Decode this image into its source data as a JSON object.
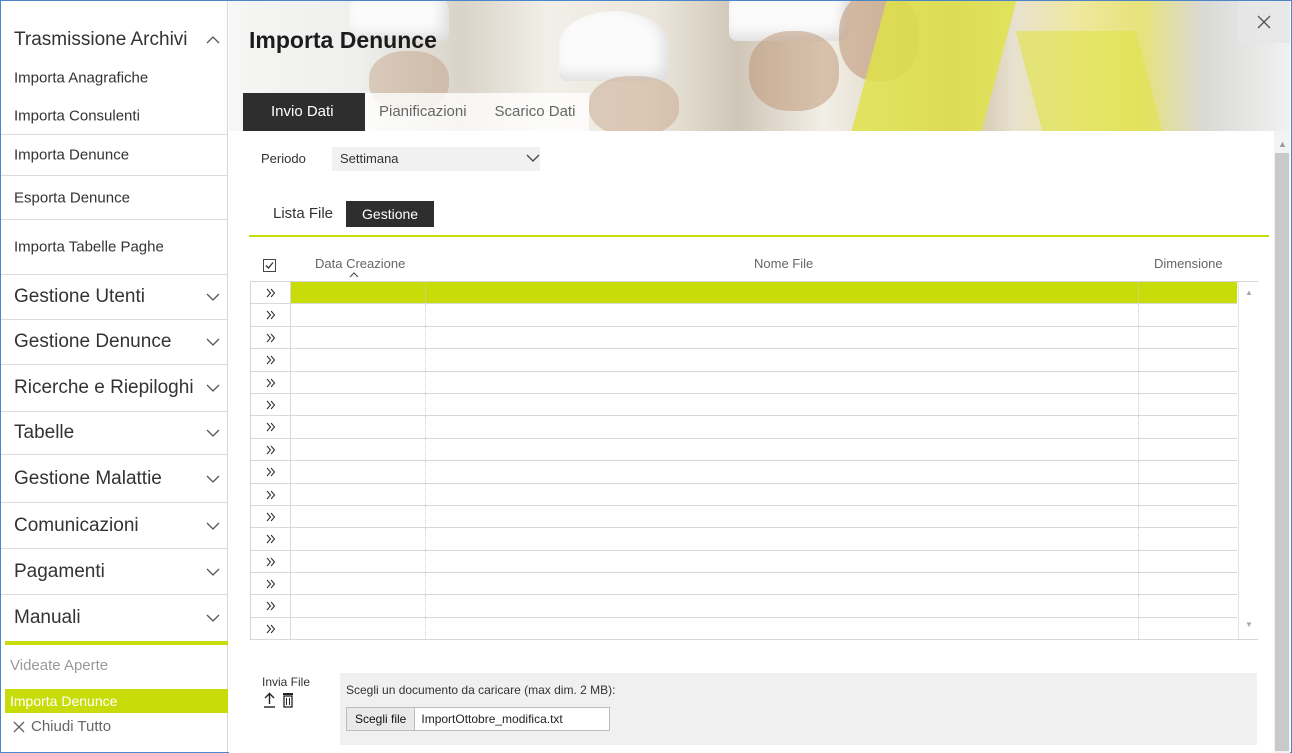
{
  "sidebar": {
    "header": "Trasmissione Archivi",
    "sub_items": [
      "Importa Anagrafiche",
      "Importa Consulenti",
      "Importa Denunce",
      "Esporta Denunce",
      "Importa Tabelle Paghe"
    ],
    "groups": [
      "Gestione Utenti",
      "Gestione Denunce",
      "Ricerche e Riepiloghi",
      "Tabelle",
      "Gestione Malattie",
      "Comunicazioni",
      "Pagamenti",
      "Manuali"
    ],
    "open_views_label": "Videate Aperte",
    "open_views": [
      "Importa Denunce"
    ],
    "close_all": "Chiudi Tutto"
  },
  "page": {
    "title": "Importa Denunce",
    "tabs": [
      "Invio Dati",
      "Pianificazioni",
      "Scarico Dati"
    ],
    "active_tab": "Invio Dati"
  },
  "filter": {
    "periodo_label": "Periodo",
    "periodo_value": "Settimana"
  },
  "subtabs": {
    "list": "Lista File",
    "manage": "Gestione",
    "active": "Gestione"
  },
  "grid": {
    "columns": [
      "Data Creazione",
      "Nome File",
      "Dimensione"
    ],
    "row_count": 16,
    "highlighted_row": 0
  },
  "upload": {
    "label": "Invia File",
    "hint": "Scegli un documento da caricare (max dim. 2 MB):",
    "button": "Scegli file",
    "file_name": "ImportOttobre_modifica.txt"
  },
  "colors": {
    "accent": "#c8dc0a",
    "dark": "#2e2e2e"
  }
}
